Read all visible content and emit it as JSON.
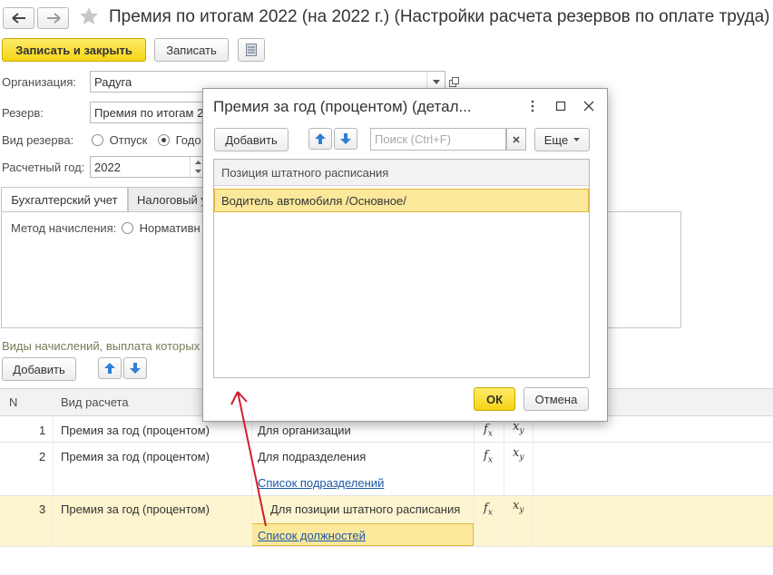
{
  "window": {
    "title": "Премия по итогам 2022 (на 2022 г.) (Настройки расчета резервов по оплате труда)"
  },
  "toolbar": {
    "save_close_label": "Записать и закрыть",
    "save_label": "Записать"
  },
  "form": {
    "organization_label": "Организация:",
    "organization_value": "Радуга",
    "reserve_label": "Резерв:",
    "reserve_value": "Премия по итогам 2",
    "reserve_type_label": "Вид резерва:",
    "reserve_type_option1": "Отпуск",
    "reserve_type_option2": "Годо",
    "year_label": "Расчетный год:",
    "year_value": "2022"
  },
  "tabs": {
    "accounting": "Бухгалтерский учет",
    "tax": "Налоговый у"
  },
  "method": {
    "label": "Метод начисления:",
    "option1": "Нормативн"
  },
  "accruals": {
    "section_label": "Виды начислений, выплата которых",
    "add_label": "Добавить",
    "col_n": "N",
    "col_type": "Вид расчета",
    "rows": [
      {
        "n": "1",
        "type": "Премия за год (процентом)",
        "scope": "Для организации",
        "fx": "fx",
        "xy": "xy",
        "link": ""
      },
      {
        "n": "2",
        "type": "Премия за год (процентом)",
        "scope": "Для подразделения",
        "fx": "fx",
        "xy": "xy",
        "link": "Список подразделений"
      },
      {
        "n": "3",
        "type": "Премия за год (процентом)",
        "scope": "Для позиции штатного расписания",
        "fx": "fx",
        "xy": "xy",
        "link": "Список должностей"
      }
    ]
  },
  "dialog": {
    "title": "Премия за год (процентом) (детал...",
    "add_label": "Добавить",
    "search_placeholder": "Поиск (Ctrl+F)",
    "more_label": "Еще",
    "column_header": "Позиция штатного расписания",
    "row1": "Водитель автомобиля /Основное/",
    "ok_label": "ОК",
    "cancel_label": "Отмена"
  },
  "colors": {
    "accent_yellow": "#f5d414",
    "selection": "#fbe89a",
    "highlight_row": "#fdf5d0",
    "link": "#1c58a6",
    "annotation_arrow": "#d21f2f"
  }
}
